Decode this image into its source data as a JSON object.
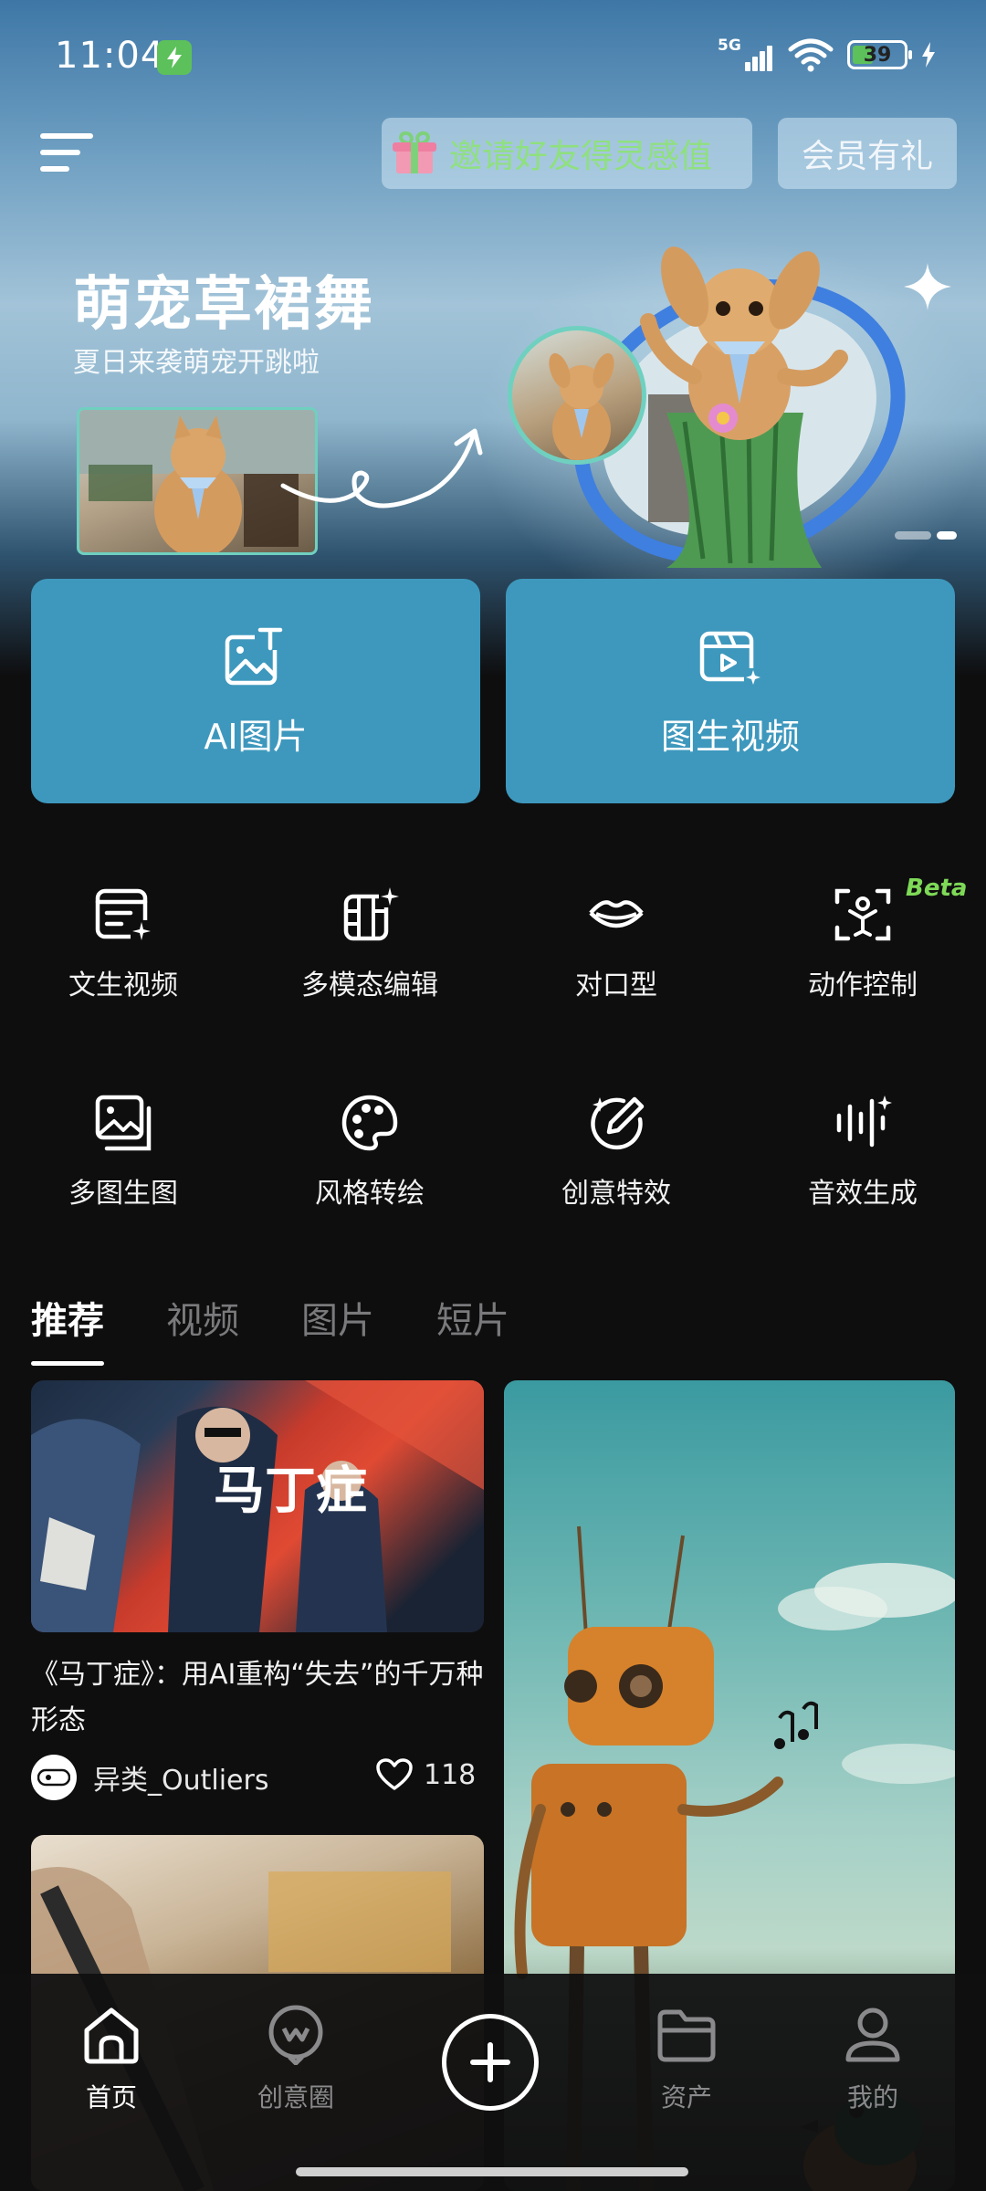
{
  "status_bar": {
    "time": "11:04",
    "network": "5G",
    "battery_percent": "39",
    "charging_icon": "bolt-icon",
    "wifi_icon": "wifi-icon"
  },
  "header": {
    "menu_icon": "menu-icon",
    "invite_label": "邀请好友得灵感值",
    "vip_label": "会员有礼"
  },
  "banner": {
    "title": "萌宠草裙舞",
    "subtitle": "夏日来袭萌宠开跳啦",
    "active_slide": 2,
    "slide_count": 2
  },
  "feature_cards": [
    {
      "label": "AI图片",
      "icon": "image-text-icon"
    },
    {
      "label": "图生视频",
      "icon": "image-video-icon"
    }
  ],
  "tools": [
    {
      "label": "文生视频",
      "icon": "text-video-icon"
    },
    {
      "label": "多模态编辑",
      "icon": "multimodal-edit-icon"
    },
    {
      "label": "对口型",
      "icon": "lips-icon"
    },
    {
      "label": "动作控制",
      "icon": "motion-control-icon",
      "badge": "Beta"
    },
    {
      "label": "多图生图",
      "icon": "multi-image-icon"
    },
    {
      "label": "风格转绘",
      "icon": "palette-icon"
    },
    {
      "label": "创意特效",
      "icon": "magic-pen-icon"
    },
    {
      "label": "音效生成",
      "icon": "sound-wave-icon"
    }
  ],
  "tabs": [
    {
      "label": "推荐",
      "active": true
    },
    {
      "label": "视频",
      "active": false
    },
    {
      "label": "图片",
      "active": false
    },
    {
      "label": "短片",
      "active": false
    }
  ],
  "feed": {
    "card1": {
      "title": "《马丁症》：用AI重构“失去”的千万种形态",
      "image_text": "马丁症",
      "author": "异类_Outliers",
      "likes": "118"
    }
  },
  "nav": [
    {
      "label": "首页",
      "icon": "home-icon",
      "active": true
    },
    {
      "label": "创意圈",
      "icon": "community-icon",
      "active": false
    },
    {
      "label": "",
      "icon": "add-icon",
      "active": false
    },
    {
      "label": "资产",
      "icon": "folder-icon",
      "active": false
    },
    {
      "label": "我的",
      "icon": "profile-icon",
      "active": false
    }
  ],
  "colors": {
    "card_blue": "#3e98bd",
    "accent_green": "#7ed957",
    "background": "#0e0e0f"
  }
}
